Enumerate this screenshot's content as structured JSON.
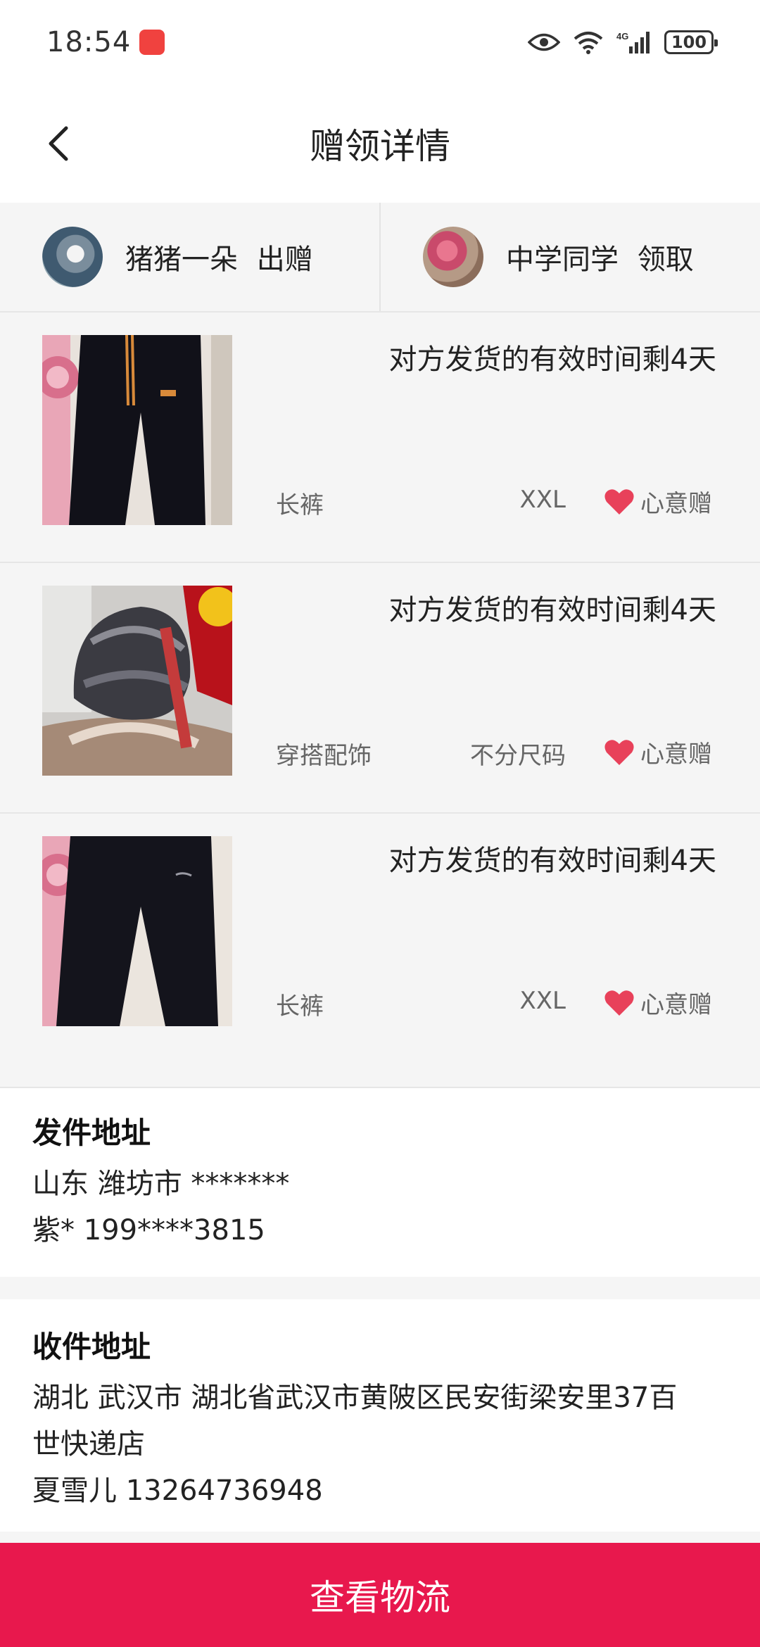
{
  "status_bar": {
    "time": "18:54",
    "app_badge": "HUAWEI",
    "network": "4G",
    "battery": "100"
  },
  "header": {
    "title": "赠领详情"
  },
  "giver": {
    "name": "猪猪一朵",
    "action": "出赠"
  },
  "receiver": {
    "name": "中学同学",
    "action": "领取"
  },
  "items": [
    {
      "deadline": "对方发货的有效时间剩4天",
      "category": "长裤",
      "size": "XXL",
      "gift_type": "心意赠",
      "thumb": "black-pants"
    },
    {
      "deadline": "对方发货的有效时间剩4天",
      "category": "穿搭配饰",
      "size": "不分尺码",
      "gift_type": "心意赠",
      "thumb": "fur-hat"
    },
    {
      "deadline": "对方发货的有效时间剩4天",
      "category": "长裤",
      "size": "XXL",
      "gift_type": "心意赠",
      "thumb": "black-pants"
    }
  ],
  "sender_address": {
    "title": "发件地址",
    "region": "山东 潍坊市 *******",
    "contact": "紫* 199****3815"
  },
  "receiver_address": {
    "title": "收件地址",
    "line1": "湖北 武汉市 湖北省武汉市黄陂区民安街梁安里37百",
    "line2": "世快递店",
    "contact": "夏雪儿 13264736948"
  },
  "action_button": {
    "label": "查看物流"
  },
  "colors": {
    "accent": "#e8184d",
    "heart": "#e8415a"
  }
}
